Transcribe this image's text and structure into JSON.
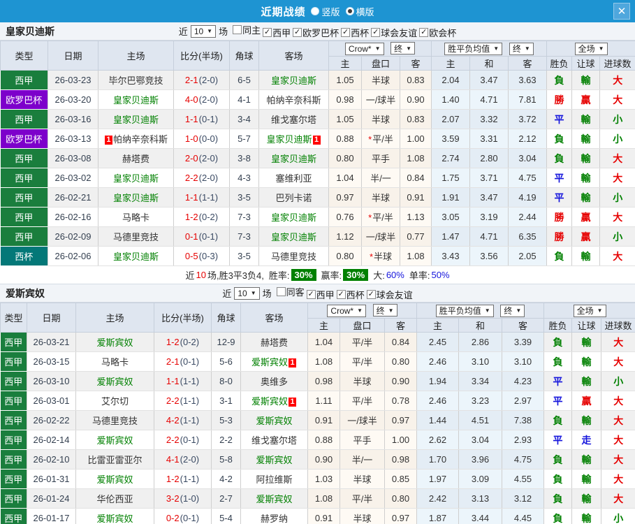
{
  "icons": {
    "chevron_down": "▼",
    "close": "✕",
    "check": "✓"
  },
  "colors": {
    "titlebar_bg": "#1e94d2",
    "team_highlight": "#008000",
    "score_main": "#e60000",
    "percent_blue": "#1414dc",
    "rate_badge_bg": "#008000",
    "red_card_bg": "#ff0000",
    "type_badges": {
      "西甲": "#1a7e3d",
      "欧罗巴杯": "#7d00cb",
      "西杯": "#047878"
    },
    "result_text": {
      "勝": "#e60000",
      "平": "#1414dc",
      "負": "#008000",
      "贏": "#e60000",
      "輸": "#008000",
      "走": "#1414dc",
      "大": "#e60000",
      "小": "#008000"
    }
  },
  "titlebar": {
    "title": "近期战绩",
    "layout_options": [
      {
        "label": "竖版",
        "selected": false
      },
      {
        "label": "横版",
        "selected": true
      }
    ]
  },
  "sections": [
    {
      "team": "皇家贝迪斯",
      "filter": {
        "near": "近",
        "count": "10",
        "unit": "场",
        "checkboxes": [
          {
            "label": "同主",
            "checked": false
          },
          {
            "label": "西甲",
            "checked": true
          },
          {
            "label": "欧罗巴杯",
            "checked": true
          },
          {
            "label": "西杯",
            "checked": true
          },
          {
            "label": "球会友谊",
            "checked": true
          },
          {
            "label": "欧会杯",
            "checked": true
          }
        ]
      },
      "header": {
        "cols": [
          "类型",
          "日期",
          "主场",
          "比分(半场)",
          "角球",
          "客场"
        ],
        "odds_source": "Crow*",
        "odds_stage": "终",
        "avg_source": "胜平负均值",
        "avg_stage": "终",
        "scope": "全场",
        "odds_sub": [
          "主",
          "盘口",
          "客"
        ],
        "avg_sub": [
          "主",
          "和",
          "客"
        ],
        "result_sub": [
          "胜负",
          "让球",
          "进球数"
        ]
      },
      "rows": [
        {
          "type": "西甲",
          "date": "26-03-23",
          "home": "毕尔巴鄂竞技",
          "home_hl": false,
          "home_card": "",
          "score": "2-1",
          "half": "(2-0)",
          "corner": "6-5",
          "away": "皇家贝迪斯",
          "away_hl": true,
          "away_card": "",
          "o_home": "1.05",
          "line": "半球",
          "line_star": false,
          "o_away": "0.83",
          "avg_win": "2.04",
          "avg_draw": "3.47",
          "avg_lose": "3.63",
          "r_wdl": "負",
          "r_line": "輸",
          "r_goal": "大"
        },
        {
          "type": "欧罗巴杯",
          "date": "26-03-20",
          "home": "皇家贝迪斯",
          "home_hl": true,
          "home_card": "",
          "score": "4-0",
          "half": "(2-0)",
          "corner": "4-1",
          "away": "帕纳辛奈科斯",
          "away_hl": false,
          "away_card": "",
          "o_home": "0.98",
          "line": "一/球半",
          "line_star": false,
          "o_away": "0.90",
          "avg_win": "1.40",
          "avg_draw": "4.71",
          "avg_lose": "7.81",
          "r_wdl": "勝",
          "r_line": "贏",
          "r_goal": "大"
        },
        {
          "type": "西甲",
          "date": "26-03-16",
          "home": "皇家贝迪斯",
          "home_hl": true,
          "home_card": "",
          "score": "1-1",
          "half": "(0-1)",
          "corner": "3-4",
          "away": "维戈塞尔塔",
          "away_hl": false,
          "away_card": "",
          "o_home": "1.05",
          "line": "半球",
          "line_star": false,
          "o_away": "0.83",
          "avg_win": "2.07",
          "avg_draw": "3.32",
          "avg_lose": "3.72",
          "r_wdl": "平",
          "r_line": "輸",
          "r_goal": "小"
        },
        {
          "type": "欧罗巴杯",
          "date": "26-03-13",
          "home": "帕纳辛奈科斯",
          "home_hl": false,
          "home_card": "1",
          "score": "1-0",
          "half": "(0-0)",
          "corner": "5-7",
          "away": "皇家贝迪斯",
          "away_hl": true,
          "away_card": "1",
          "o_home": "0.88",
          "line": "平/半",
          "line_star": true,
          "o_away": "1.00",
          "avg_win": "3.59",
          "avg_draw": "3.31",
          "avg_lose": "2.12",
          "r_wdl": "負",
          "r_line": "輸",
          "r_goal": "小"
        },
        {
          "type": "西甲",
          "date": "26-03-08",
          "home": "赫塔费",
          "home_hl": false,
          "home_card": "",
          "score": "2-0",
          "half": "(2-0)",
          "corner": "3-8",
          "away": "皇家贝迪斯",
          "away_hl": true,
          "away_card": "",
          "o_home": "0.80",
          "line": "平手",
          "line_star": false,
          "o_away": "1.08",
          "avg_win": "2.74",
          "avg_draw": "2.80",
          "avg_lose": "3.04",
          "r_wdl": "負",
          "r_line": "輸",
          "r_goal": "大"
        },
        {
          "type": "西甲",
          "date": "26-03-02",
          "home": "皇家贝迪斯",
          "home_hl": true,
          "home_card": "",
          "score": "2-2",
          "half": "(2-0)",
          "corner": "4-3",
          "away": "塞维利亚",
          "away_hl": false,
          "away_card": "",
          "o_home": "1.04",
          "line": "半/一",
          "line_star": false,
          "o_away": "0.84",
          "avg_win": "1.75",
          "avg_draw": "3.71",
          "avg_lose": "4.75",
          "r_wdl": "平",
          "r_line": "輸",
          "r_goal": "大"
        },
        {
          "type": "西甲",
          "date": "26-02-21",
          "home": "皇家贝迪斯",
          "home_hl": true,
          "home_card": "",
          "score": "1-1",
          "half": "(1-1)",
          "corner": "3-5",
          "away": "巴列卡诺",
          "away_hl": false,
          "away_card": "",
          "o_home": "0.97",
          "line": "半球",
          "line_star": false,
          "o_away": "0.91",
          "avg_win": "1.91",
          "avg_draw": "3.47",
          "avg_lose": "4.19",
          "r_wdl": "平",
          "r_line": "輸",
          "r_goal": "小"
        },
        {
          "type": "西甲",
          "date": "26-02-16",
          "home": "马略卡",
          "home_hl": false,
          "home_card": "",
          "score": "1-2",
          "half": "(0-2)",
          "corner": "7-3",
          "away": "皇家贝迪斯",
          "away_hl": true,
          "away_card": "",
          "o_home": "0.76",
          "line": "平/半",
          "line_star": true,
          "o_away": "1.13",
          "avg_win": "3.05",
          "avg_draw": "3.19",
          "avg_lose": "2.44",
          "r_wdl": "勝",
          "r_line": "贏",
          "r_goal": "大"
        },
        {
          "type": "西甲",
          "date": "26-02-09",
          "home": "马德里竞技",
          "home_hl": false,
          "home_card": "",
          "score": "0-1",
          "half": "(0-1)",
          "corner": "7-3",
          "away": "皇家贝迪斯",
          "away_hl": true,
          "away_card": "",
          "o_home": "1.12",
          "line": "一/球半",
          "line_star": false,
          "o_away": "0.77",
          "avg_win": "1.47",
          "avg_draw": "4.71",
          "avg_lose": "6.35",
          "r_wdl": "勝",
          "r_line": "贏",
          "r_goal": "小"
        },
        {
          "type": "西杯",
          "date": "26-02-06",
          "home": "皇家贝迪斯",
          "home_hl": true,
          "home_card": "",
          "score": "0-5",
          "half": "(0-3)",
          "corner": "3-5",
          "away": "马德里竞技",
          "away_hl": false,
          "away_card": "",
          "o_home": "0.80",
          "line": "半球",
          "line_star": true,
          "o_away": "1.08",
          "avg_win": "3.43",
          "avg_draw": "3.56",
          "avg_lose": "2.05",
          "r_wdl": "負",
          "r_line": "輸",
          "r_goal": "大"
        }
      ],
      "summary": {
        "near": "近",
        "count": "10",
        "text": "场,胜3平3负4,",
        "win_label": "胜率:",
        "win_value": "30%",
        "profit_label": "赢率:",
        "profit_value": "30%",
        "big_label": "大:",
        "big_value": "60%",
        "single_label": "单率:",
        "single_value": "50%"
      }
    },
    {
      "team": "爱斯宾奴",
      "filter": {
        "near": "近",
        "count": "10",
        "unit": "场",
        "checkboxes": [
          {
            "label": "同客",
            "checked": false
          },
          {
            "label": "西甲",
            "checked": true
          },
          {
            "label": "西杯",
            "checked": true
          },
          {
            "label": "球会友谊",
            "checked": true
          }
        ]
      },
      "header": {
        "cols": [
          "类型",
          "日期",
          "主场",
          "比分(半场)",
          "角球",
          "客场"
        ],
        "odds_source": "Crow*",
        "odds_stage": "终",
        "avg_source": "胜平负均值",
        "avg_stage": "终",
        "scope": "全场",
        "odds_sub": [
          "主",
          "盘口",
          "客"
        ],
        "avg_sub": [
          "主",
          "和",
          "客"
        ],
        "result_sub": [
          "胜负",
          "让球",
          "进球数"
        ]
      },
      "rows": [
        {
          "type": "西甲",
          "date": "26-03-21",
          "home": "爱斯宾奴",
          "home_hl": true,
          "home_card": "",
          "score": "1-2",
          "half": "(0-2)",
          "corner": "12-9",
          "away": "赫塔费",
          "away_hl": false,
          "away_card": "",
          "o_home": "1.04",
          "line": "平/半",
          "line_star": false,
          "o_away": "0.84",
          "avg_win": "2.45",
          "avg_draw": "2.86",
          "avg_lose": "3.39",
          "r_wdl": "負",
          "r_line": "輸",
          "r_goal": "大"
        },
        {
          "type": "西甲",
          "date": "26-03-15",
          "home": "马略卡",
          "home_hl": false,
          "home_card": "",
          "score": "2-1",
          "half": "(0-1)",
          "corner": "5-6",
          "away": "爱斯宾奴",
          "away_hl": true,
          "away_card": "1",
          "o_home": "1.08",
          "line": "平/半",
          "line_star": false,
          "o_away": "0.80",
          "avg_win": "2.46",
          "avg_draw": "3.10",
          "avg_lose": "3.10",
          "r_wdl": "負",
          "r_line": "輸",
          "r_goal": "大"
        },
        {
          "type": "西甲",
          "date": "26-03-10",
          "home": "爱斯宾奴",
          "home_hl": true,
          "home_card": "",
          "score": "1-1",
          "half": "(1-1)",
          "corner": "8-0",
          "away": "奥维多",
          "away_hl": false,
          "away_card": "",
          "o_home": "0.98",
          "line": "半球",
          "line_star": false,
          "o_away": "0.90",
          "avg_win": "1.94",
          "avg_draw": "3.34",
          "avg_lose": "4.23",
          "r_wdl": "平",
          "r_line": "輸",
          "r_goal": "小"
        },
        {
          "type": "西甲",
          "date": "26-03-01",
          "home": "艾尔切",
          "home_hl": false,
          "home_card": "",
          "score": "2-2",
          "half": "(1-1)",
          "corner": "3-1",
          "away": "爱斯宾奴",
          "away_hl": true,
          "away_card": "1",
          "o_home": "1.11",
          "line": "平/半",
          "line_star": false,
          "o_away": "0.78",
          "avg_win": "2.46",
          "avg_draw": "3.23",
          "avg_lose": "2.97",
          "r_wdl": "平",
          "r_line": "贏",
          "r_goal": "大"
        },
        {
          "type": "西甲",
          "date": "26-02-22",
          "home": "马德里竞技",
          "home_hl": false,
          "home_card": "",
          "score": "4-2",
          "half": "(1-1)",
          "corner": "5-3",
          "away": "爱斯宾奴",
          "away_hl": true,
          "away_card": "",
          "o_home": "0.91",
          "line": "一/球半",
          "line_star": false,
          "o_away": "0.97",
          "avg_win": "1.44",
          "avg_draw": "4.51",
          "avg_lose": "7.38",
          "r_wdl": "負",
          "r_line": "輸",
          "r_goal": "大"
        },
        {
          "type": "西甲",
          "date": "26-02-14",
          "home": "爱斯宾奴",
          "home_hl": true,
          "home_card": "",
          "score": "2-2",
          "half": "(0-1)",
          "corner": "2-2",
          "away": "维戈塞尔塔",
          "away_hl": false,
          "away_card": "",
          "o_home": "0.88",
          "line": "平手",
          "line_star": false,
          "o_away": "1.00",
          "avg_win": "2.62",
          "avg_draw": "3.04",
          "avg_lose": "2.93",
          "r_wdl": "平",
          "r_line": "走",
          "r_goal": "大"
        },
        {
          "type": "西甲",
          "date": "26-02-10",
          "home": "比雷亚雷亚尔",
          "home_hl": false,
          "home_card": "",
          "score": "4-1",
          "half": "(2-0)",
          "corner": "5-8",
          "away": "爱斯宾奴",
          "away_hl": true,
          "away_card": "",
          "o_home": "0.90",
          "line": "半/一",
          "line_star": false,
          "o_away": "0.98",
          "avg_win": "1.70",
          "avg_draw": "3.96",
          "avg_lose": "4.75",
          "r_wdl": "負",
          "r_line": "輸",
          "r_goal": "大"
        },
        {
          "type": "西甲",
          "date": "26-01-31",
          "home": "爱斯宾奴",
          "home_hl": true,
          "home_card": "",
          "score": "1-2",
          "half": "(1-1)",
          "corner": "4-2",
          "away": "阿拉维斯",
          "away_hl": false,
          "away_card": "",
          "o_home": "1.03",
          "line": "半球",
          "line_star": false,
          "o_away": "0.85",
          "avg_win": "1.97",
          "avg_draw": "3.09",
          "avg_lose": "4.55",
          "r_wdl": "負",
          "r_line": "輸",
          "r_goal": "大"
        },
        {
          "type": "西甲",
          "date": "26-01-24",
          "home": "华伦西亚",
          "home_hl": false,
          "home_card": "",
          "score": "3-2",
          "half": "(1-0)",
          "corner": "2-7",
          "away": "爱斯宾奴",
          "away_hl": true,
          "away_card": "",
          "o_home": "1.08",
          "line": "平/半",
          "line_star": false,
          "o_away": "0.80",
          "avg_win": "2.42",
          "avg_draw": "3.13",
          "avg_lose": "3.12",
          "r_wdl": "負",
          "r_line": "輸",
          "r_goal": "大"
        },
        {
          "type": "西甲",
          "date": "26-01-17",
          "home": "爱斯宾奴",
          "home_hl": true,
          "home_card": "",
          "score": "0-2",
          "half": "(0-1)",
          "corner": "5-4",
          "away": "赫罗纳",
          "away_hl": false,
          "away_card": "",
          "o_home": "0.91",
          "line": "半球",
          "line_star": false,
          "o_away": "0.97",
          "avg_win": "1.87",
          "avg_draw": "3.44",
          "avg_lose": "4.45",
          "r_wdl": "負",
          "r_line": "輸",
          "r_goal": "小"
        }
      ]
    }
  ]
}
